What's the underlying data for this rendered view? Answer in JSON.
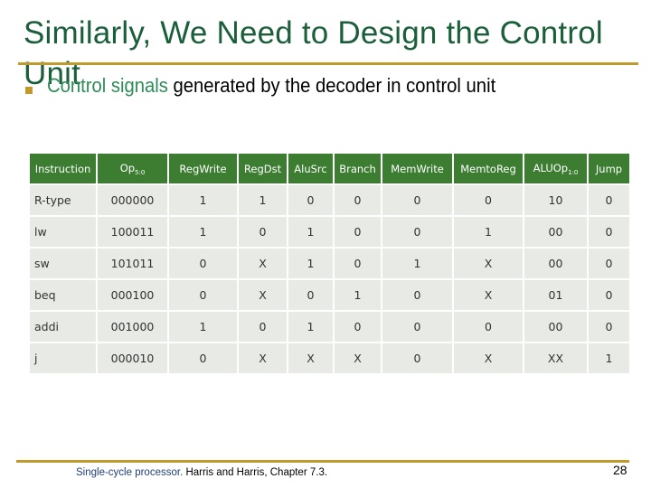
{
  "slide": {
    "title": "Similarly, We Need to Design the Control Unit",
    "bullet": {
      "accent_text": "Control signals",
      "rest_text": " generated by the decoder in control unit"
    },
    "colors": {
      "title": "#1a5e3a",
      "accent": "#2e8b57",
      "rule": "#c09a2c",
      "header_bg": "#3c7d32",
      "cell_bg": "#e8eae6"
    },
    "footer": {
      "link_text": "Single-cycle processor.",
      "rest_text": " Harris and Harris, Chapter 7.3."
    },
    "page_number": "28"
  },
  "table": {
    "headers": [
      {
        "label": "Instruction",
        "sub": ""
      },
      {
        "label": "Op",
        "sub": "5:0"
      },
      {
        "label": "RegWrite",
        "sub": ""
      },
      {
        "label": "RegDst",
        "sub": ""
      },
      {
        "label": "AluSrc",
        "sub": ""
      },
      {
        "label": "Branch",
        "sub": ""
      },
      {
        "label": "MemWrite",
        "sub": ""
      },
      {
        "label": "MemtoReg",
        "sub": ""
      },
      {
        "label": "ALUOp",
        "sub": "1:0"
      },
      {
        "label": "Jump",
        "sub": ""
      }
    ],
    "rows": [
      [
        "R-type",
        "000000",
        "1",
        "1",
        "0",
        "0",
        "0",
        "0",
        "10",
        "0"
      ],
      [
        "lw",
        "100011",
        "1",
        "0",
        "1",
        "0",
        "0",
        "1",
        "00",
        "0"
      ],
      [
        "sw",
        "101011",
        "0",
        "X",
        "1",
        "0",
        "1",
        "X",
        "00",
        "0"
      ],
      [
        "beq",
        "000100",
        "0",
        "X",
        "0",
        "1",
        "0",
        "X",
        "01",
        "0"
      ],
      [
        "addi",
        "001000",
        "1",
        "0",
        "1",
        "0",
        "0",
        "0",
        "00",
        "0"
      ],
      [
        "j",
        "000010",
        "0",
        "X",
        "X",
        "X",
        "0",
        "X",
        "XX",
        "1"
      ]
    ]
  }
}
